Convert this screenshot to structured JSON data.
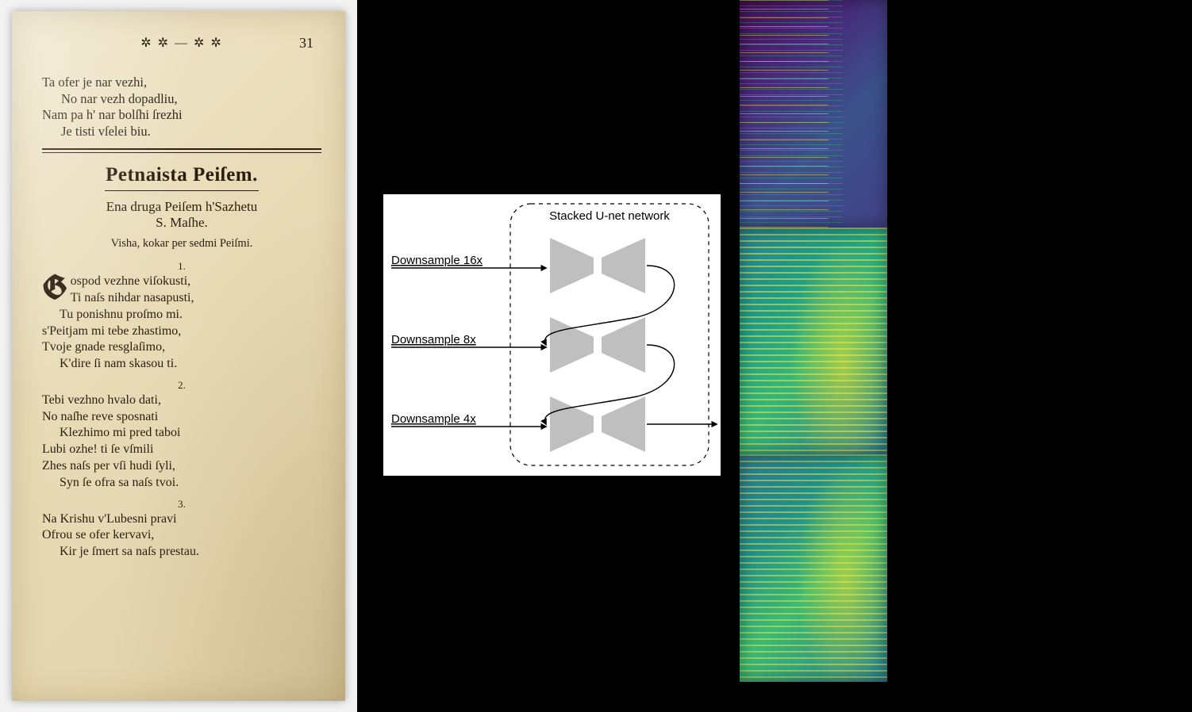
{
  "book": {
    "page_number": "31",
    "ornament": "✲ ✲ — ✲ ✲",
    "pre_verse": {
      "l1": "Ta ofer je nar vezhi,",
      "l2": "No nar vezh dopadliu,",
      "l3": "Nam pa h' nar bolſhi ſrezhi",
      "l4": "Je tisti vſelei biu."
    },
    "title": "Petnaista Peiſem.",
    "subtitle_l1": "Ena druga Peiſem h'Sazhetu",
    "subtitle_l2": "S. Maſhe.",
    "note": "Visha, kokar per sedmi Peiſmi.",
    "stanzas": [
      {
        "n": "1.",
        "lines": [
          "Gospod vezhne viſokusti,",
          "Ti naſs nihdar nasapusti,",
          "Tu ponishnu proſmo mi.",
          "s'Peitjam mi tebe zhastimo,",
          "Tvoje gnade resglaſimo,",
          "K'dire ſi nam skasou ti."
        ]
      },
      {
        "n": "2.",
        "lines": [
          "Tebi vezhno hvalo dati,",
          "No naſhe reve sposnati",
          "Klezhimo mi pred taboi",
          "Lubi ozhe! ti ſe vſmili",
          "Zhes naſs per vſi hudi ſyli,",
          "Syn ſe ofra sa naſs tvoi."
        ]
      },
      {
        "n": "3.",
        "lines": [
          "Na Krishu v'Lubesni pravi",
          "Ofrou se ofer kervavi,",
          "Kir je ſmert sa naſs prestau."
        ]
      }
    ]
  },
  "diagram": {
    "title": "Stacked U-net network",
    "labels": {
      "d16": "Downsample 16x",
      "d8": "Downsample 8x",
      "d4": "Downsample 4x"
    }
  },
  "spectrograms": {
    "panels": [
      "harmonic-top",
      "spectrogram-mid",
      "spectrogram-bottom"
    ]
  }
}
